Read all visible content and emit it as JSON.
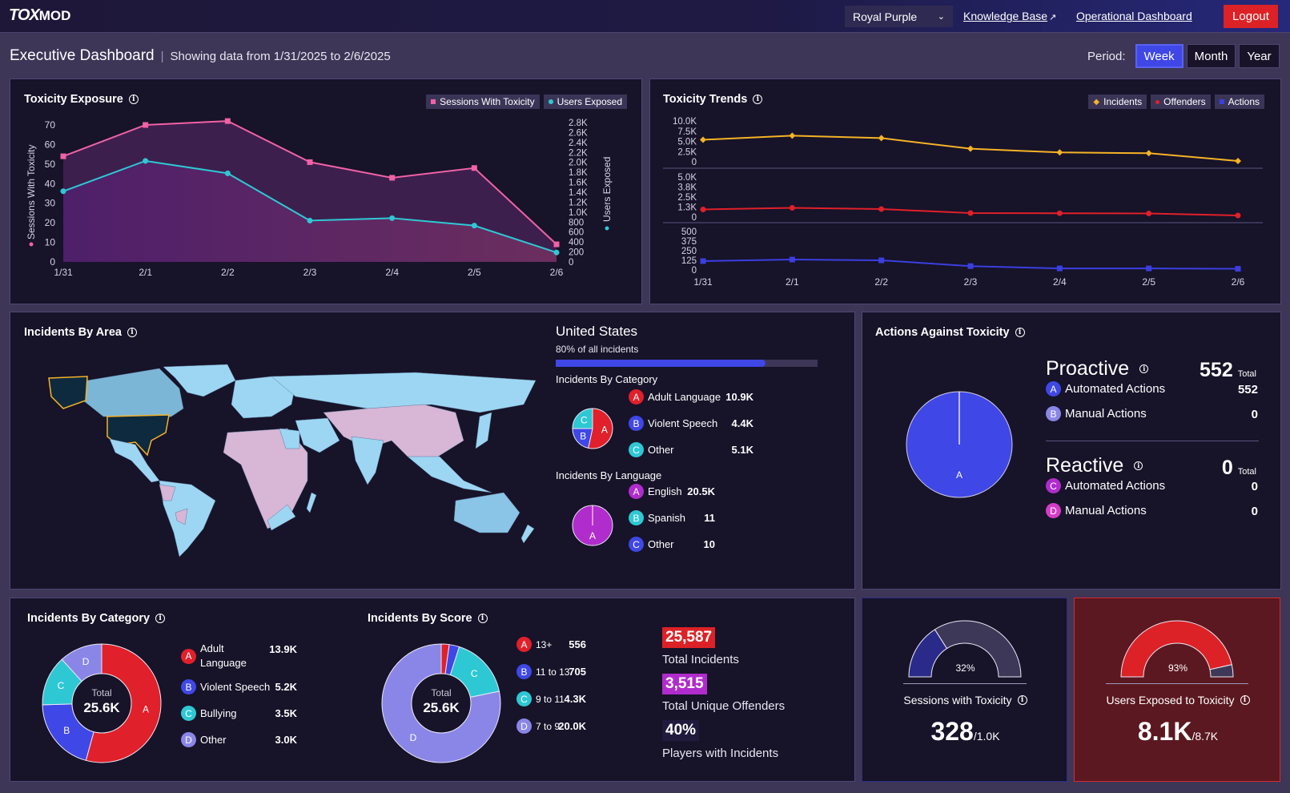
{
  "brand": {
    "logo_main": "TOX",
    "logo_sub": "MOD"
  },
  "topbar": {
    "theme_select": "Royal Purple",
    "knowledge_base": "Knowledge Base",
    "operational_dashboard": "Operational Dashboard",
    "logout": "Logout"
  },
  "page": {
    "title": "Executive Dashboard",
    "separator": "|",
    "range_text": "Showing data from 1/31/2025 to 2/6/2025",
    "period_label": "Period:",
    "periods": [
      "Week",
      "Month",
      "Year"
    ],
    "active_period": "Week"
  },
  "toxicity_exposure": {
    "title": "Toxicity Exposure",
    "legend": [
      "Sessions With Toxicity",
      "Users Exposed"
    ],
    "colors": {
      "sessions": "#f062a6",
      "users": "#2ec8d4"
    }
  },
  "toxicity_trends": {
    "title": "Toxicity Trends",
    "legend": [
      "Incidents",
      "Offenders",
      "Actions"
    ],
    "colors": {
      "incidents": "#f5b325",
      "offenders": "#e0202a",
      "actions": "#3b3fe0"
    }
  },
  "incidents_by_area": {
    "title": "Incidents By Area",
    "selected_country": "United States",
    "share_text": "80% of all incidents",
    "share_fraction": 0.8,
    "category_title": "Incidents By Category",
    "categories": [
      {
        "badge": "A",
        "label": "Adult Language",
        "value": "10.9K",
        "color": "#e0202a"
      },
      {
        "badge": "B",
        "label": "Violent Speech",
        "value": "4.4K",
        "color": "#3f47e6"
      },
      {
        "badge": "C",
        "label": "Other",
        "value": "5.1K",
        "color": "#2ec8d4"
      }
    ],
    "language_title": "Incidents By Language",
    "languages": [
      {
        "badge": "A",
        "label": "English",
        "value": "20.5K",
        "color": "#b02ccc"
      },
      {
        "badge": "B",
        "label": "Spanish",
        "value": "11",
        "color": "#2ec8d4"
      },
      {
        "badge": "C",
        "label": "Other",
        "value": "10",
        "color": "#3f47e6"
      }
    ]
  },
  "actions": {
    "title": "Actions Against Toxicity",
    "pie_label": "A",
    "proactive": {
      "title": "Proactive",
      "total": "552",
      "total_label": "Total",
      "items": [
        {
          "badge": "A",
          "label": "Automated Actions",
          "value": "552",
          "color": "#3f47e6"
        },
        {
          "badge": "B",
          "label": "Manual Actions",
          "value": "0",
          "color": "#8a86e8"
        }
      ]
    },
    "reactive": {
      "title": "Reactive",
      "total": "0",
      "total_label": "Total",
      "items": [
        {
          "badge": "C",
          "label": "Automated Actions",
          "value": "0",
          "color": "#b02ccc"
        },
        {
          "badge": "D",
          "label": "Manual Actions",
          "value": "0",
          "color": "#d63cc8"
        }
      ]
    }
  },
  "category_card": {
    "title": "Incidents By Category",
    "center_label": "Total",
    "center_value": "25.6K",
    "items": [
      {
        "badge": "A",
        "label": "Adult Language",
        "value": "13.9K",
        "color": "#e0202a"
      },
      {
        "badge": "B",
        "label": "Violent Speech",
        "value": "5.2K",
        "color": "#3f47e6"
      },
      {
        "badge": "C",
        "label": "Bullying",
        "value": "3.5K",
        "color": "#2ec8d4"
      },
      {
        "badge": "D",
        "label": "Other",
        "value": "3.0K",
        "color": "#8a86e8"
      }
    ]
  },
  "score_card": {
    "title": "Incidents By Score",
    "center_label": "Total",
    "center_value": "25.6K",
    "items": [
      {
        "badge": "A",
        "label": "13+",
        "value": "556",
        "color": "#e0202a"
      },
      {
        "badge": "B",
        "label": "11 to 13",
        "value": "705",
        "color": "#3f47e6"
      },
      {
        "badge": "C",
        "label": "9 to 11",
        "value": "4.3K",
        "color": "#2ec8d4"
      },
      {
        "badge": "D",
        "label": "7 to 9",
        "value": "20.0K",
        "color": "#8a86e8"
      }
    ],
    "stats": [
      {
        "value": "25,587",
        "label": "Total Incidents",
        "color": "#dc2226"
      },
      {
        "value": "3,515",
        "label": "Total Unique Offenders",
        "color": "#b02ccc"
      },
      {
        "value": "40%",
        "label": "Players with Incidents",
        "color": "#201a3d"
      }
    ]
  },
  "sessions_gauge": {
    "title": "Sessions with Toxicity",
    "percent_text": "32%",
    "fraction": 0.32,
    "value": "328",
    "total": "/1.0K"
  },
  "users_gauge": {
    "title": "Users Exposed to Toxicity",
    "percent_text": "93%",
    "fraction": 0.93,
    "value": "8.1K",
    "total": "/8.7K"
  },
  "chart_data": [
    {
      "type": "area",
      "title": "Toxicity Exposure",
      "x": [
        "1/31",
        "2/1",
        "2/2",
        "2/3",
        "2/4",
        "2/5",
        "2/6"
      ],
      "series": [
        {
          "name": "Sessions With Toxicity",
          "axis": "left",
          "values": [
            54,
            70,
            72,
            51,
            43,
            48,
            9
          ]
        },
        {
          "name": "Users Exposed",
          "axis": "right",
          "values": [
            1420,
            2030,
            1780,
            830,
            880,
            730,
            190
          ]
        }
      ],
      "ylabel": "Sessions With Toxicity",
      "y2label": "Users Exposed",
      "ylim": [
        0,
        70
      ],
      "y2lim": [
        0,
        2800
      ],
      "yticks": [
        "0",
        "10",
        "20",
        "30",
        "40",
        "50",
        "60",
        "70"
      ],
      "y2ticks": [
        "0",
        "200",
        "400",
        "600",
        "800",
        "1.0K",
        "1.2K",
        "1.4K",
        "1.6K",
        "1.8K",
        "2.0K",
        "2.2K",
        "2.4K",
        "2.6K",
        "2.8K"
      ],
      "legend": "top-right"
    },
    {
      "type": "line",
      "title": "Toxicity Trends",
      "x": [
        "1/31",
        "2/1",
        "2/2",
        "2/3",
        "2/4",
        "2/5",
        "2/6"
      ],
      "series": [
        {
          "name": "Incidents",
          "values": [
            5400,
            6400,
            5800,
            3200,
            2300,
            2100,
            200
          ],
          "ylim": [
            0,
            10000
          ],
          "ticks": [
            "0",
            "2.5K",
            "5.0K",
            "7.5K",
            "10.0K"
          ]
        },
        {
          "name": "Offenders",
          "values": [
            950,
            1150,
            1000,
            500,
            480,
            450,
            200
          ],
          "ylim": [
            0,
            5000
          ],
          "ticks": [
            "0",
            "1.3K",
            "2.5K",
            "3.8K",
            "5.0K"
          ]
        },
        {
          "name": "Actions",
          "values": [
            115,
            135,
            125,
            50,
            20,
            20,
            15
          ],
          "ylim": [
            0,
            500
          ],
          "ticks": [
            "0",
            "125",
            "250",
            "375",
            "500"
          ]
        }
      ],
      "legend": "top-right"
    },
    {
      "type": "pie",
      "title": "Incidents By Category (United States)",
      "categories": [
        "Adult Language",
        "Violent Speech",
        "Other"
      ],
      "values": [
        10900,
        4400,
        5100
      ]
    },
    {
      "type": "pie",
      "title": "Incidents By Language (United States)",
      "categories": [
        "English",
        "Spanish",
        "Other"
      ],
      "values": [
        20500,
        11,
        10
      ]
    },
    {
      "type": "pie",
      "title": "Actions Against Toxicity",
      "categories": [
        "Proactive Automated",
        "Proactive Manual",
        "Reactive Automated",
        "Reactive Manual"
      ],
      "values": [
        552,
        0,
        0,
        0
      ]
    },
    {
      "type": "pie",
      "title": "Incidents By Category",
      "categories": [
        "Adult Language",
        "Violent Speech",
        "Bullying",
        "Other"
      ],
      "values": [
        13900,
        5200,
        3500,
        3000
      ]
    },
    {
      "type": "pie",
      "title": "Incidents By Score",
      "categories": [
        "13+",
        "11 to 13",
        "9 to 11",
        "7 to 9"
      ],
      "values": [
        556,
        705,
        4300,
        20000
      ]
    }
  ]
}
